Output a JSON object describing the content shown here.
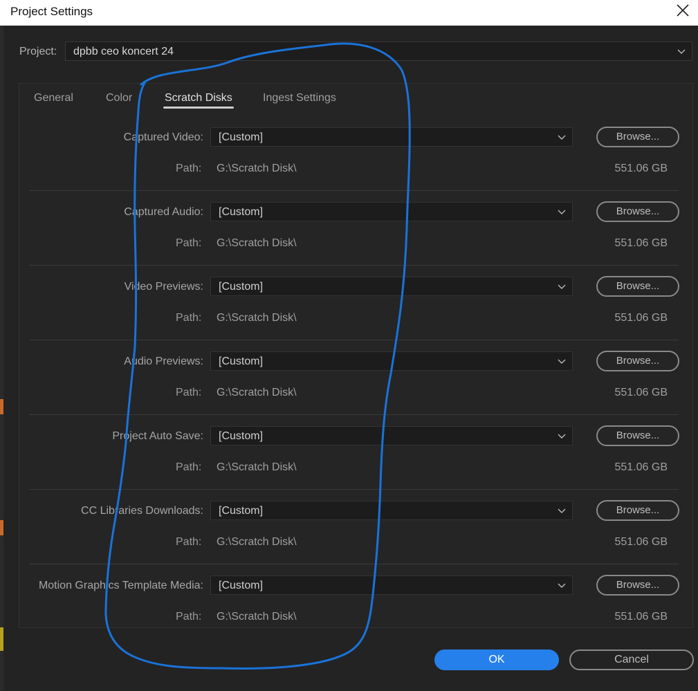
{
  "window": {
    "title": "Project Settings"
  },
  "project": {
    "label": "Project:",
    "value": "dpbb ceo koncert 24"
  },
  "tabs": [
    {
      "label": "General",
      "active": false
    },
    {
      "label": "Color",
      "active": false
    },
    {
      "label": "Scratch Disks",
      "active": true
    },
    {
      "label": "Ingest Settings",
      "active": false
    }
  ],
  "scratch_disks": [
    {
      "label": "Captured Video:",
      "value": "[Custom]",
      "browse": "Browse...",
      "path_label": "Path:",
      "path": "G:\\Scratch Disk\\",
      "size": "551.06 GB"
    },
    {
      "label": "Captured Audio:",
      "value": "[Custom]",
      "browse": "Browse...",
      "path_label": "Path:",
      "path": "G:\\Scratch Disk\\",
      "size": "551.06 GB"
    },
    {
      "label": "Video Previews:",
      "value": "[Custom]",
      "browse": "Browse...",
      "path_label": "Path:",
      "path": "G:\\Scratch Disk\\",
      "size": "551.06 GB"
    },
    {
      "label": "Audio Previews:",
      "value": "[Custom]",
      "browse": "Browse...",
      "path_label": "Path:",
      "path": "G:\\Scratch Disk\\",
      "size": "551.06 GB"
    },
    {
      "label": "Project Auto Save:",
      "value": "[Custom]",
      "browse": "Browse...",
      "path_label": "Path:",
      "path": "G:\\Scratch Disk\\",
      "size": "551.06 GB"
    },
    {
      "label": "CC Libraries Downloads:",
      "value": "[Custom]",
      "browse": "Browse...",
      "path_label": "Path:",
      "path": "G:\\Scratch Disk\\",
      "size": "551.06 GB"
    },
    {
      "label": "Motion Graphics Template Media:",
      "value": "[Custom]",
      "browse": "Browse...",
      "path_label": "Path:",
      "path": "G:\\Scratch Disk\\",
      "size": "551.06 GB"
    }
  ],
  "buttons": {
    "ok": "OK",
    "cancel": "Cancel"
  },
  "colors": {
    "accent": "#2680eb",
    "annotation": "#1a73d9",
    "background": "#232323"
  },
  "icons": {
    "close": "close-icon",
    "dropdown": "chevron-down-icon"
  }
}
